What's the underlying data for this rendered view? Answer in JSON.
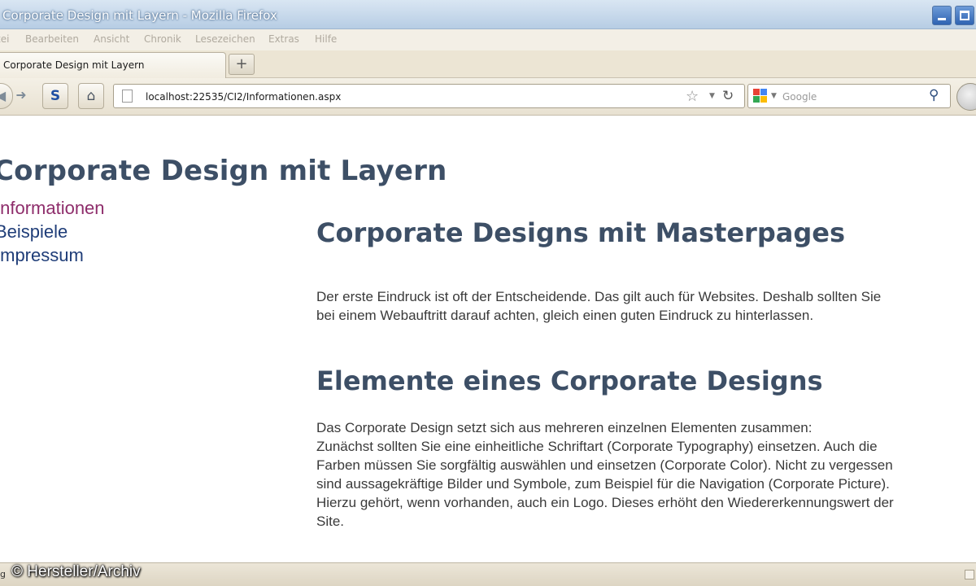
{
  "window": {
    "title": "Corporate Design mit Layern - Mozilla Firefox"
  },
  "menu": [
    "tei",
    "Bearbeiten",
    "Ansicht",
    "Chronik",
    "Lesezeichen",
    "Extras",
    "Hilfe"
  ],
  "tabs": {
    "active_label": "Corporate Design mit Layern",
    "new_tab_label": "+"
  },
  "toolbar": {
    "back_icon": "back-arrow-icon",
    "forward_icon": "forward-arrow-icon",
    "sync_icon": "sync-icon",
    "home_icon": "home-icon",
    "url": "localhost:22535/CI2/Informationen.aspx",
    "search_placeholder": "Google"
  },
  "page": {
    "site_title": "Corporate Design mit Layern",
    "nav": [
      {
        "label": "Informationen",
        "active": true
      },
      {
        "label": "Beispiele",
        "active": false
      },
      {
        "label": "Impressum",
        "active": false
      }
    ],
    "section1": {
      "heading": "Corporate Designs mit Masterpages",
      "lines": [
        "Der erste Eindruck ist oft der Entscheidende. Das gilt auch für Websites. Deshalb sollten Sie",
        "bei einem Webauftritt darauf achten, gleich einen guten Eindruck zu hinterlassen."
      ]
    },
    "section2": {
      "heading": "Elemente eines Corporate Designs",
      "lines": [
        "Das Corporate Design setzt sich aus mehreren einzelnen Elementen zusammen:",
        "Zunächst sollten Sie eine einheitliche Schriftart (Corporate Typography) einsetzen.  Auch die",
        "Farben müssen Sie sorgfältig auswählen und einsetzen (Corporate Color). Nicht zu vergessen",
        "sind aussagekräftige Bilder und Symbole, zum Beispiel für die Navigation (Corporate Picture).",
        "Hierzu gehört, wenn vorhanden, auch ein Logo. Dieses erhöht den Wiedererkennungswert der",
        "Site."
      ]
    }
  },
  "status": {
    "text": "g",
    "watermark": "© Hersteller/Archiv"
  },
  "colors": {
    "heading": "#3d4f66",
    "nav_link": "#1f3d78",
    "nav_link_active": "#8e2d6b",
    "body_text": "#3a3a3a",
    "titlebar": "#b7cde4"
  }
}
